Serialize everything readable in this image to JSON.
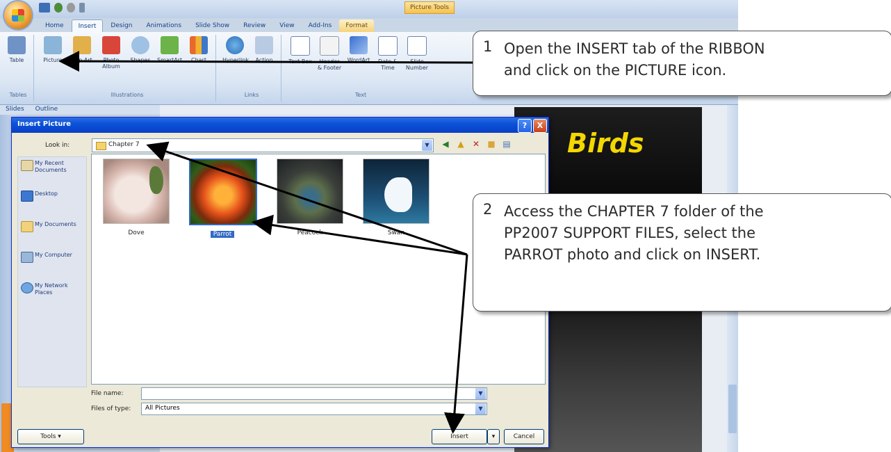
{
  "app": {
    "contextual_tab_group": "Picture Tools",
    "tabs": [
      "Home",
      "Insert",
      "Design",
      "Animations",
      "Slide Show",
      "Review",
      "View",
      "Add-Ins",
      "Format"
    ]
  },
  "ribbon": {
    "buttons": [
      "Table",
      "Picture",
      "Clip Art",
      "Photo Album",
      "Shapes",
      "SmartArt",
      "Chart",
      "Hyperlink",
      "Action",
      "Text Box",
      "Header & Footer",
      "WordArt",
      "Date & Time",
      "Slide Number"
    ],
    "groups": [
      "Tables",
      "Illustrations",
      "Links",
      "Text"
    ]
  },
  "pane_tabs": [
    "Slides",
    "Outline"
  ],
  "slide": {
    "title_fragment": "Birds"
  },
  "dialog": {
    "title": "Insert Picture",
    "help_label": "?",
    "close_label": "X",
    "look_in_label": "Look in:",
    "look_in_value": "Chapter 7",
    "places": [
      "My Recent Documents",
      "Desktop",
      "My Documents",
      "My Computer",
      "My Network Places"
    ],
    "files": [
      {
        "name": "Dove",
        "selected": false
      },
      {
        "name": "Parrot",
        "selected": true
      },
      {
        "name": "Peacock",
        "selected": false
      },
      {
        "name": "Swan",
        "selected": false
      }
    ],
    "file_name_label": "File name:",
    "file_name_value": "",
    "files_of_type_label": "Files of type:",
    "files_of_type_value": "All Pictures",
    "tools_label": "Tools",
    "insert_label": "Insert",
    "cancel_label": "Cancel"
  },
  "callouts": [
    {
      "number": "1",
      "lines": [
        "Open the INSERT tab of the RIBBON",
        "and click on the PICTURE icon."
      ]
    },
    {
      "number": "2",
      "lines": [
        "Access the CHAPTER 7 folder of the",
        "PP2007 SUPPORT FILES, select the",
        "PARROT photo and click on INSERT."
      ]
    }
  ],
  "colors": {
    "accent": "#316ac5",
    "slide_title": "#f4d700",
    "title_bar": "#0a53d8"
  }
}
